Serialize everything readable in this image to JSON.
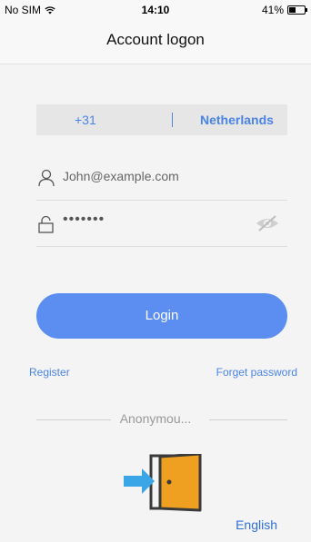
{
  "status_bar": {
    "carrier": "No SIM",
    "time": "14:10",
    "battery": "41%",
    "battery_level": 0.41
  },
  "nav": {
    "title": "Account logon"
  },
  "country": {
    "code": "+31",
    "name": "Netherlands"
  },
  "login_form": {
    "account_value": "John@example.com",
    "password_mask": "•••••••",
    "login_label": "Login"
  },
  "links": {
    "register": "Register",
    "forget_password": "Forget password"
  },
  "anonymous": {
    "label": "Anonymou..."
  },
  "language": {
    "label": "English"
  },
  "colors": {
    "accent": "#5b8ef0",
    "link": "#4a84e4",
    "door_orange": "#f0a020",
    "arrow_blue": "#3aa6e8"
  },
  "icons": [
    "wifi-icon",
    "battery-icon",
    "user-icon",
    "lock-icon",
    "eye-hidden-icon",
    "anonymous-door-icon"
  ]
}
